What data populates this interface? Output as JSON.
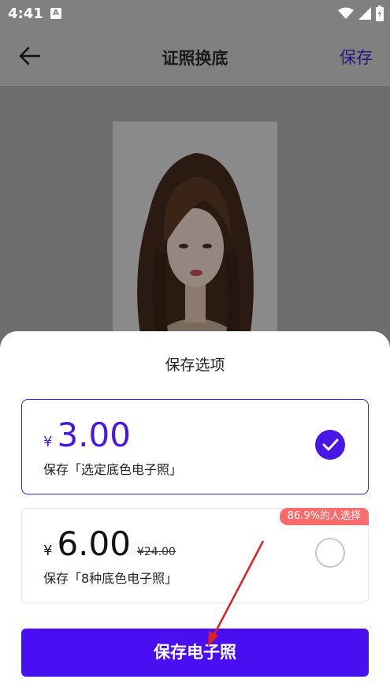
{
  "status_bar": {
    "time": "4:41",
    "notification_icon": "A"
  },
  "app_bar": {
    "title": "证照换底",
    "save_label": "保存"
  },
  "sheet": {
    "title": "保存选项",
    "options": [
      {
        "currency": "¥",
        "price": "3.00",
        "description": "保存「选定底色电子照」",
        "selected": true
      },
      {
        "currency": "¥",
        "price": "6.00",
        "original_price": "¥24.00",
        "description": "保存「8种底色电子照」",
        "badge": "86.9%的人选择",
        "selected": false
      }
    ],
    "button_label": "保存电子照"
  },
  "colors": {
    "accent": "#4a16e6",
    "badge": "#ff6b6b",
    "annotation_arrow": "#e02020"
  }
}
